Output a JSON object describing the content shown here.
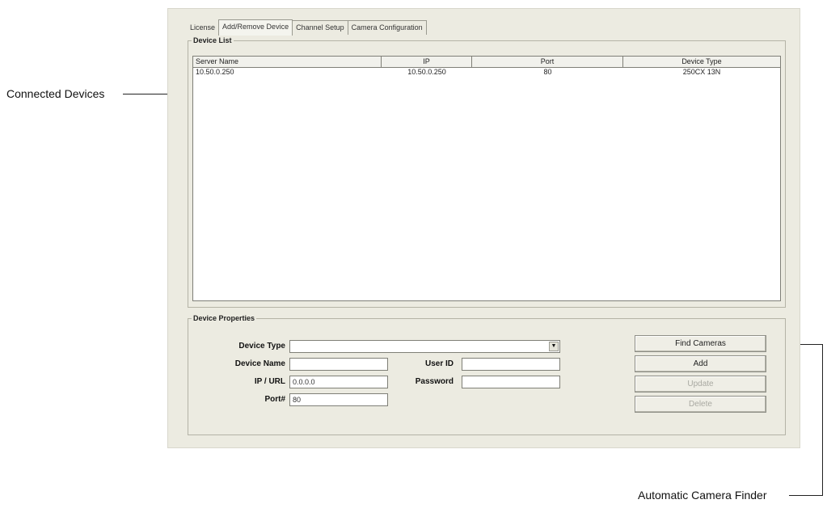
{
  "callouts": {
    "connected_devices": "Connected Devices",
    "automatic_camera_finder": "Automatic Camera Finder"
  },
  "tabs": [
    {
      "label": "License"
    },
    {
      "label": "Add/Remove Device"
    },
    {
      "label": "Channel Setup"
    },
    {
      "label": "Camera Configuration"
    }
  ],
  "device_list": {
    "legend": "Device List",
    "columns": [
      "Server Name",
      "IP",
      "Port",
      "Device Type"
    ],
    "rows": [
      {
        "server_name": "10.50.0.250",
        "ip": "10.50.0.250",
        "port": "80",
        "device_type": "250CX 13N"
      }
    ]
  },
  "device_properties": {
    "legend": "Device Properties",
    "device_type_label": "Device Type",
    "device_type_value": "",
    "device_name_label": "Device Name",
    "device_name_value": "",
    "ip_url_label": "IP / URL",
    "ip_url_value": "0.0.0.0",
    "port_label": "Port#",
    "port_value": "80",
    "user_id_label": "User ID",
    "user_id_value": "",
    "password_label": "Password",
    "password_value": ""
  },
  "buttons": {
    "find_cameras": "Find Cameras",
    "add": "Add",
    "update": "Update",
    "delete": "Delete"
  }
}
